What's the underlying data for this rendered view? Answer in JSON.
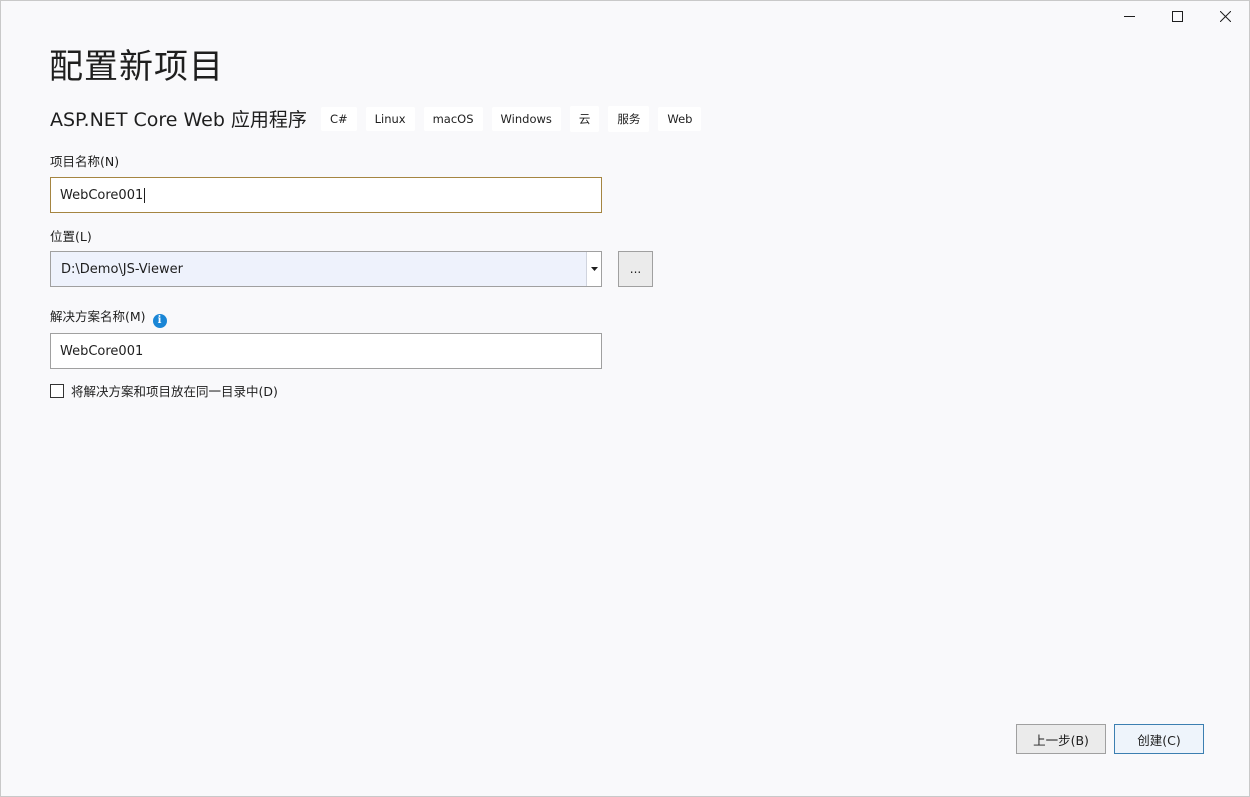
{
  "window_controls": {
    "minimize": "—",
    "maximize": "☐",
    "close": "✕"
  },
  "page_title": "配置新项目",
  "template": {
    "name": "ASP.NET Core Web 应用程序",
    "tags": [
      "C#",
      "Linux",
      "macOS",
      "Windows",
      "云",
      "服务",
      "Web"
    ]
  },
  "project_name": {
    "label": "项目名称(N)",
    "value": "WebCore001"
  },
  "location": {
    "label": "位置(L)",
    "value": "D:\\Demo\\JS-Viewer",
    "browse_label": "..."
  },
  "solution_name": {
    "label": "解决方案名称(M)",
    "info_icon": "i",
    "value": "WebCore001"
  },
  "same_directory": {
    "label": "将解决方案和项目放在同一目录中(D)",
    "checked": false
  },
  "footer": {
    "back_label": "上一步(B)",
    "create_label": "创建(C)"
  }
}
